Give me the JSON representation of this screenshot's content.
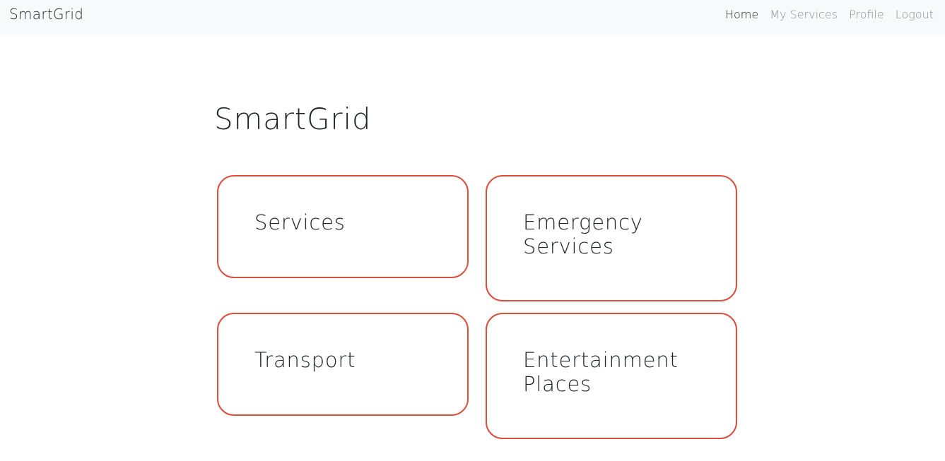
{
  "navbar": {
    "brand": "SmartGrid",
    "links": [
      {
        "label": "Home"
      },
      {
        "label": "My Services"
      },
      {
        "label": "Profile"
      },
      {
        "label": "Logout"
      }
    ]
  },
  "main": {
    "title": "SmartGrid",
    "cards": [
      {
        "line1": "Services",
        "line2": ""
      },
      {
        "line1": "Emergency",
        "line2": "Services"
      },
      {
        "line1": "Transport",
        "line2": ""
      },
      {
        "line1": "Entertainment",
        "line2": "Places"
      }
    ]
  },
  "colors": {
    "navbar_bg": "#f8f9fa",
    "card_border": "#db4f3f",
    "text": "#212529",
    "nav_muted": "#8a8e93"
  }
}
